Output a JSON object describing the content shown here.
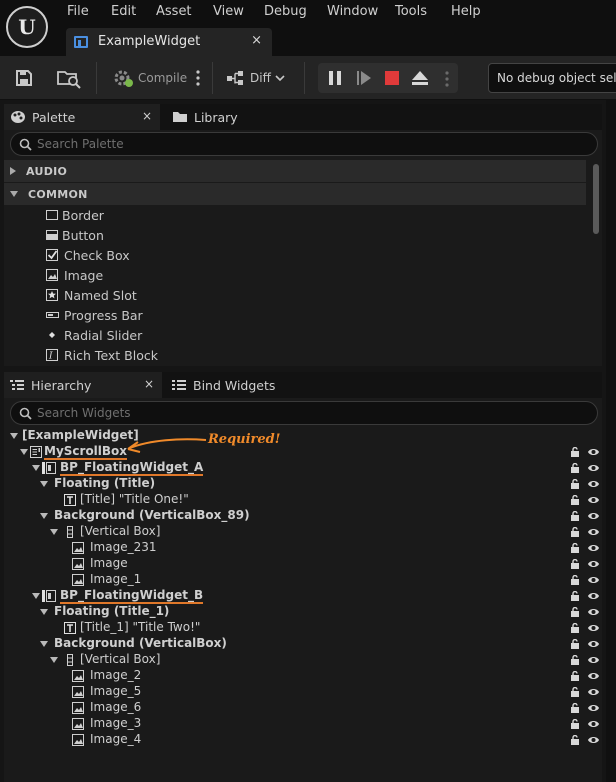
{
  "app": {
    "logo_glyph": "U",
    "menu": [
      "File",
      "Edit",
      "Asset",
      "View",
      "Debug",
      "Window",
      "Tools",
      "Help"
    ],
    "document_tab": "ExampleWidget",
    "close_glyph": "×"
  },
  "toolbar": {
    "compile_label": "Compile",
    "diff_label": "Diff",
    "debug_object": "No debug object selected"
  },
  "palette": {
    "tab_label": "Palette",
    "library_tab": "Library",
    "search_placeholder": "Search Palette",
    "categories": [
      "AUDIO",
      "COMMON"
    ],
    "items": [
      "Border",
      "Button",
      "Check Box",
      "Image",
      "Named Slot",
      "Progress Bar",
      "Radial Slider",
      "Rich Text Block"
    ]
  },
  "hierarchy": {
    "tab_label": "Hierarchy",
    "bind_tab": "Bind Widgets",
    "search_placeholder": "Search Widgets",
    "annotation": "Required!",
    "rows": [
      "[ExampleWidget]",
      "MyScrollBox",
      "BP_FloatingWidget_A",
      "Floating (Title)",
      "[Title] \"Title One!\"",
      "Background (VerticalBox_89)",
      "[Vertical Box]",
      "Image_231",
      "Image",
      "Image_1",
      "BP_FloatingWidget_B",
      "Floating (Title_1)",
      "[Title_1] \"Title Two!\"",
      "Background (VerticalBox)",
      "[Vertical Box]",
      "Image_2",
      "Image_5",
      "Image_6",
      "Image_3",
      "Image_4"
    ]
  },
  "colors": {
    "accent": "#4a8fe0",
    "annotation": "#f08a2a",
    "stop": "#e03a3a",
    "compile_green": "#7ab84a"
  }
}
